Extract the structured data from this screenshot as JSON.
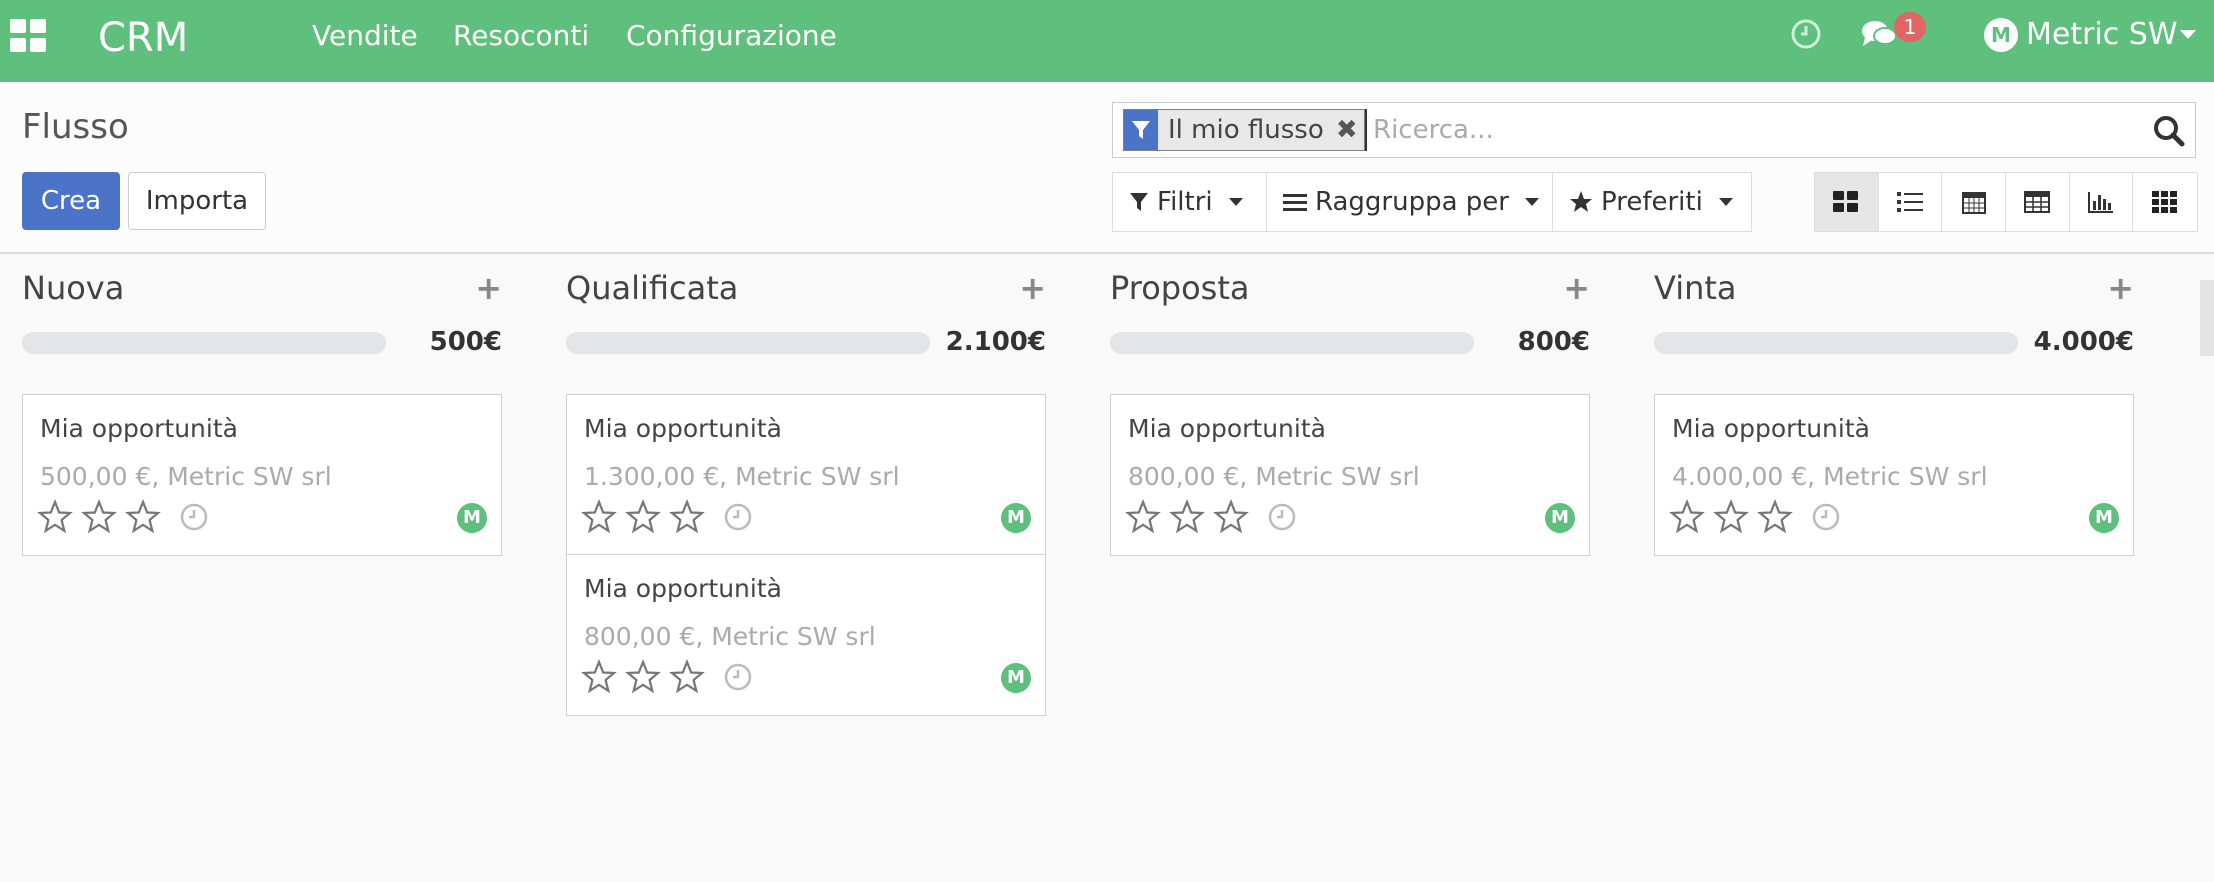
{
  "navbar": {
    "brand": "CRM",
    "menu": [
      "Vendite",
      "Resoconti",
      "Configurazione"
    ],
    "messages_badge": "1",
    "avatar_initial": "M",
    "user": "Metric SW"
  },
  "control": {
    "title": "Flusso",
    "create": "Crea",
    "import": "Importa",
    "facet_label": "Il mio flusso",
    "search_placeholder": "Ricerca...",
    "filters": "Filtri",
    "group_by": "Raggruppa per",
    "favorites": "Preferiti"
  },
  "columns": [
    {
      "title": "Nuova",
      "total": "500€",
      "cards": [
        {
          "title": "Mia opportunità",
          "subtitle": "500,00 €, Metric SW srl",
          "avatar": "M"
        }
      ]
    },
    {
      "title": "Qualificata",
      "total": "2.100€",
      "cards": [
        {
          "title": "Mia opportunità",
          "subtitle": "1.300,00 €, Metric SW srl",
          "avatar": "M"
        },
        {
          "title": "Mia opportunità",
          "subtitle": "800,00 €, Metric SW srl",
          "avatar": "M"
        }
      ]
    },
    {
      "title": "Proposta",
      "total": "800€",
      "cards": [
        {
          "title": "Mia opportunità",
          "subtitle": "800,00 €, Metric SW srl",
          "avatar": "M"
        }
      ]
    },
    {
      "title": "Vinta",
      "total": "4.000€",
      "cards": [
        {
          "title": "Mia opportunità",
          "subtitle": "4.000,00 €, Metric SW srl",
          "avatar": "M"
        }
      ]
    }
  ],
  "colors": {
    "brand": "#5ec07c",
    "primary": "#4b74c9",
    "badge": "#e06666"
  }
}
